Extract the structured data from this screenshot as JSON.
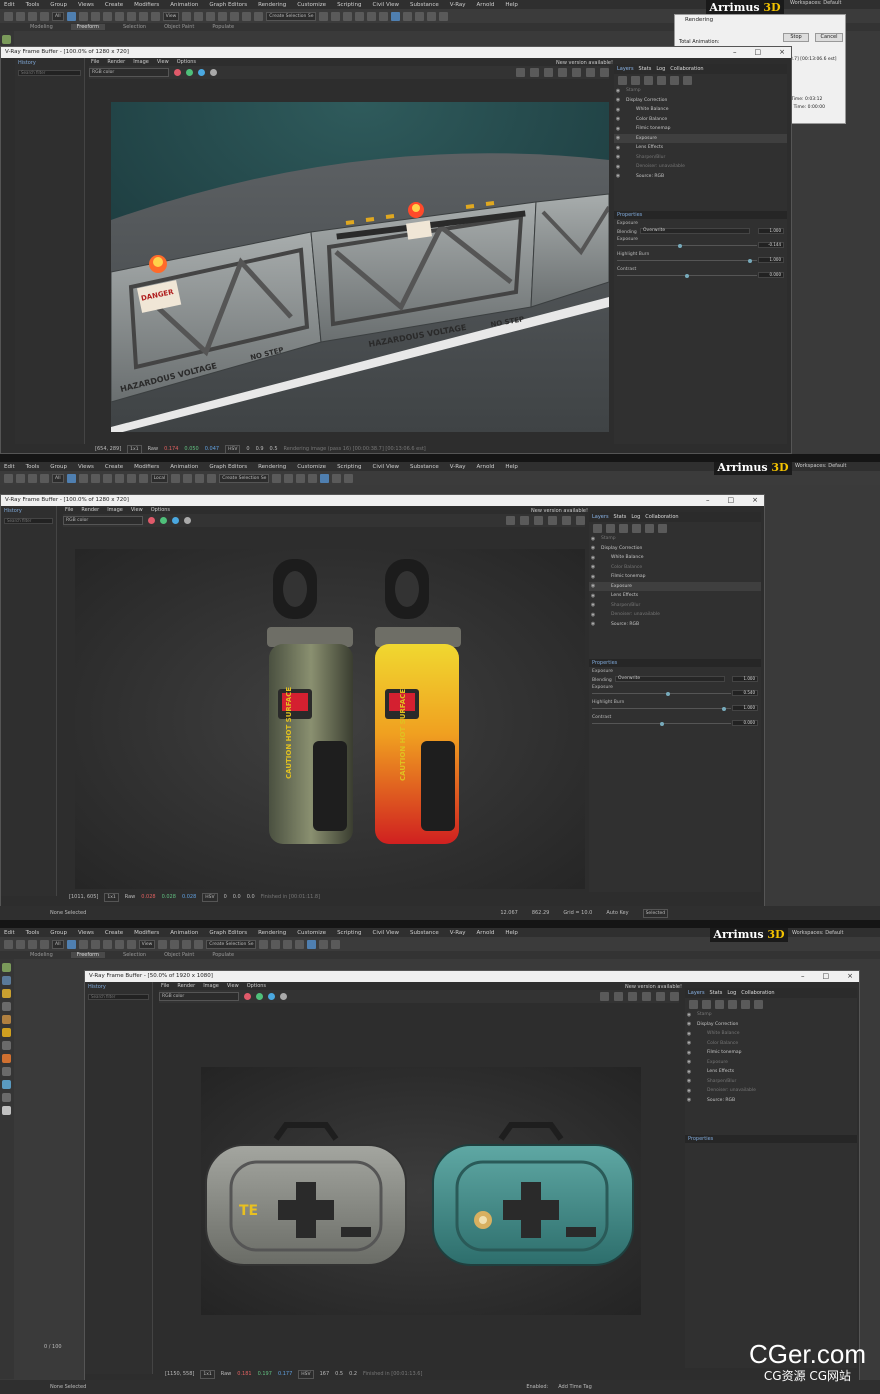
{
  "brand": {
    "name_white": "Arrimus",
    "name_yellow": "3D"
  },
  "main_menu": [
    "Edit",
    "Tools",
    "Group",
    "Views",
    "Create",
    "Modifiers",
    "Animation",
    "Graph Editors",
    "Rendering",
    "Customize",
    "Scripting",
    "Civil View",
    "Substance",
    "V-Ray",
    "Arnold",
    "Help"
  ],
  "toolbar": {
    "filter": "All",
    "view": "View",
    "selection_set": "Create Selection Se",
    "local": "Local"
  },
  "workspaces": {
    "label": "Workspaces:",
    "value": "Default"
  },
  "ribbon_tabs": [
    "Modeling",
    "Freeform",
    "Selection",
    "Object Paint",
    "Populate"
  ],
  "vfb_menu": [
    "File",
    "Render",
    "Image",
    "View",
    "Options"
  ],
  "channel": "RGB color",
  "new_version": "New version available!",
  "history": {
    "title": "History",
    "search": "Search filter"
  },
  "side_tabs": [
    "Layers",
    "Stats",
    "Log",
    "Collaboration"
  ],
  "layers": [
    {
      "label": "Stamp",
      "dim": true
    },
    {
      "label": "Display Correction",
      "dim": false
    },
    {
      "label": "White Balance",
      "dim": false
    },
    {
      "label": "Color Balance",
      "dim": false
    },
    {
      "label": "Filmic tonemap",
      "dim": false
    },
    {
      "label": "Exposure",
      "dim": false,
      "selected": true
    },
    {
      "label": "Lens Effects",
      "dim": false
    },
    {
      "label": "Sharpen/Blur",
      "dim": true
    },
    {
      "label": "Denoiser: unavailable",
      "dim": true
    },
    {
      "label": "Source: RGB",
      "dim": false
    }
  ],
  "properties": {
    "title": "Properties",
    "section": "Exposure",
    "blending_label": "Blending",
    "blending_value": "Overwrite",
    "exposure_label": "Exposure",
    "highlight_label": "Highlight Burn",
    "contrast_label": "Contrast"
  },
  "panels": [
    {
      "title": "V-Ray Frame Buffer - [100.0% of 1280 x 720]",
      "coords": "[654, 289]",
      "ratio": "1x1",
      "raw": "Raw",
      "r": "0.174",
      "g": "0.050",
      "b": "0.047",
      "mode": "HSV",
      "h": "0",
      "s": "0.9",
      "v": "0.5",
      "finished": "Rendering image (pass 16) [00:00:38.7] [00:13:06.6 est]",
      "blend": "1.000",
      "exposure": "-0.144",
      "exposure_pos": 0.45,
      "highlight": "1.000",
      "highlight_pos": 0.95,
      "contrast": "0.000",
      "contrast_pos": 0.5
    },
    {
      "title": "V-Ray Frame Buffer - [100.0% of 1280 x 720]",
      "coords": "[1011, 605]",
      "ratio": "1x1",
      "raw": "Raw",
      "r": "0.028",
      "g": "0.028",
      "b": "0.028",
      "mode": "HSV",
      "h": "0",
      "s": "0.0",
      "v": "0.0",
      "finished": "Finished in [00:01:11.8]",
      "blend": "1.000",
      "exposure": "0.540",
      "exposure_pos": 0.55,
      "highlight": "1.000",
      "highlight_pos": 0.95,
      "contrast": "0.000",
      "contrast_pos": 0.5
    },
    {
      "title": "V-Ray Frame Buffer - [50.0% of 1920 x 1080]",
      "coords": "[1150, 558]",
      "ratio": "1x1",
      "raw": "Raw",
      "r": "0.181",
      "g": "0.197",
      "b": "0.177",
      "mode": "HSV",
      "h": "167",
      "s": "0.5",
      "v": "0.2",
      "finished": "Finished in [00:01:13.6]"
    }
  ],
  "rendering_dialog": {
    "title": "Rendering",
    "total_animation": "Total Animation:",
    "stop": "Stop",
    "cancel": "Cancel",
    "time1": "Time: 0:03:12",
    "time2": "l Time: 0:00:00",
    "est": "38.7] [00:13:06.6 est]"
  },
  "status_bar": {
    "none_selected": "None Selected",
    "grid": "Grid = 10.0",
    "auto_key": "Auto Key",
    "selected": "Selected",
    "x_val": "12.067",
    "y_val": "862.29",
    "enabled": "Enabled:",
    "add_time_tag": "Add Time Tag",
    "frame": "0 / 100"
  },
  "decals": {
    "danger": "DANGER",
    "hazard": "HAZARDOUS VOLTAGE",
    "no_step": "NO STEP",
    "caution": "CAUTION HOT SURFACE",
    "te": "TE"
  },
  "watermark": {
    "big": "CGer.com",
    "small": "CG资源 CG网站"
  },
  "colors": {
    "accent": "#4f7fb0",
    "tab_blue": "#8ab4e8",
    "brand_yellow": "#f2c200"
  }
}
